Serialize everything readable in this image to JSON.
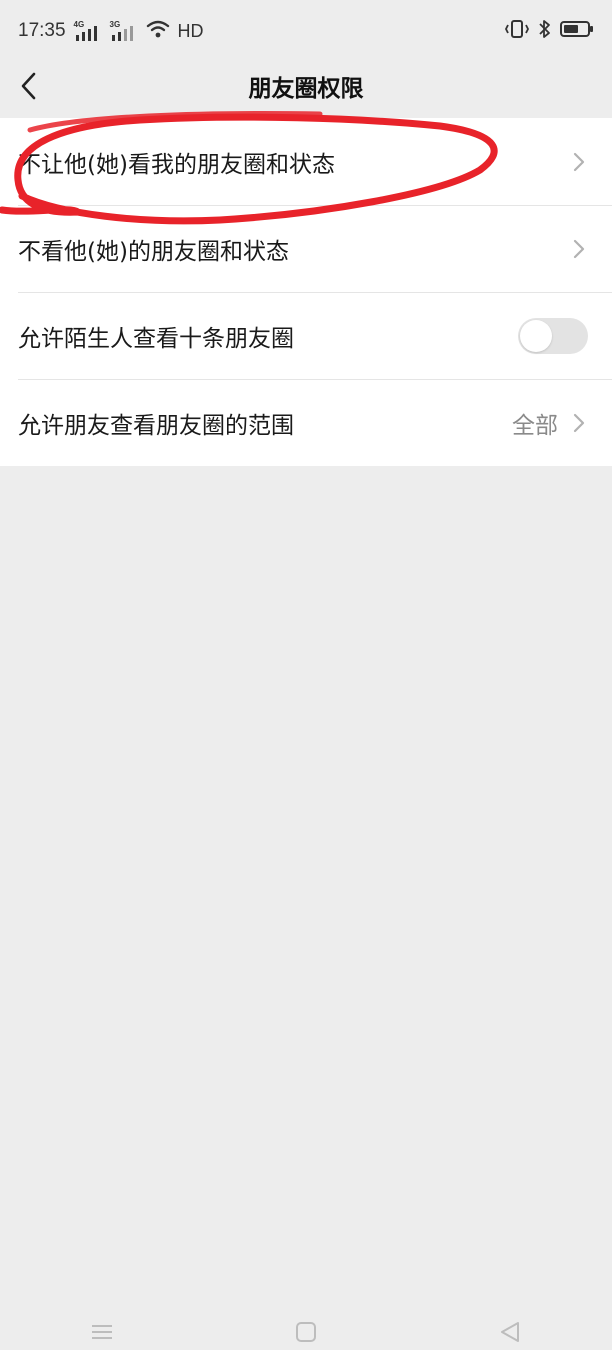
{
  "status_bar": {
    "time": "17:35",
    "network1": "4G",
    "network2": "3G",
    "hd": "HD"
  },
  "header": {
    "title": "朋友圈权限"
  },
  "settings": {
    "items": [
      {
        "label": "不让他(她)看我的朋友圈和状态"
      },
      {
        "label": "不看他(她)的朋友圈和状态"
      },
      {
        "label": "允许陌生人查看十条朋友圈"
      },
      {
        "label": "允许朋友查看朋友圈的范围",
        "value": "全部"
      }
    ]
  },
  "colors": {
    "annotation": "#e8232a",
    "background": "#ededed",
    "toggle_off": "#e3e3e3"
  }
}
